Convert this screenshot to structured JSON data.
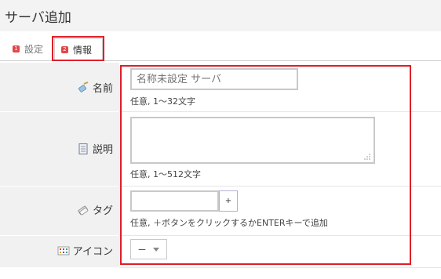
{
  "header": {
    "title": "サーバ追加"
  },
  "tabs": [
    {
      "num": "1",
      "label": "設定"
    },
    {
      "num": "2",
      "label": "情報"
    }
  ],
  "fields": {
    "name": {
      "label": "名前",
      "icon": "tag-pen-icon",
      "placeholder": "名称未設定 サーバ",
      "hint": "任意, 1〜32文字"
    },
    "description": {
      "label": "説明",
      "icon": "notepad-icon",
      "value": "",
      "hint": "任意, 1〜512文字"
    },
    "tags": {
      "label": "タグ",
      "icon": "tags-icon",
      "value": "",
      "add_button": "+",
      "hint": "任意, ＋ボタンをクリックするかENTERキーで追加"
    },
    "icon": {
      "label": "アイコン",
      "icon": "icon-grid-icon",
      "selected": "－"
    }
  },
  "colors": {
    "highlight": "#e01e28",
    "label_bg": "#f1f1f1",
    "badge": "#e04848"
  }
}
